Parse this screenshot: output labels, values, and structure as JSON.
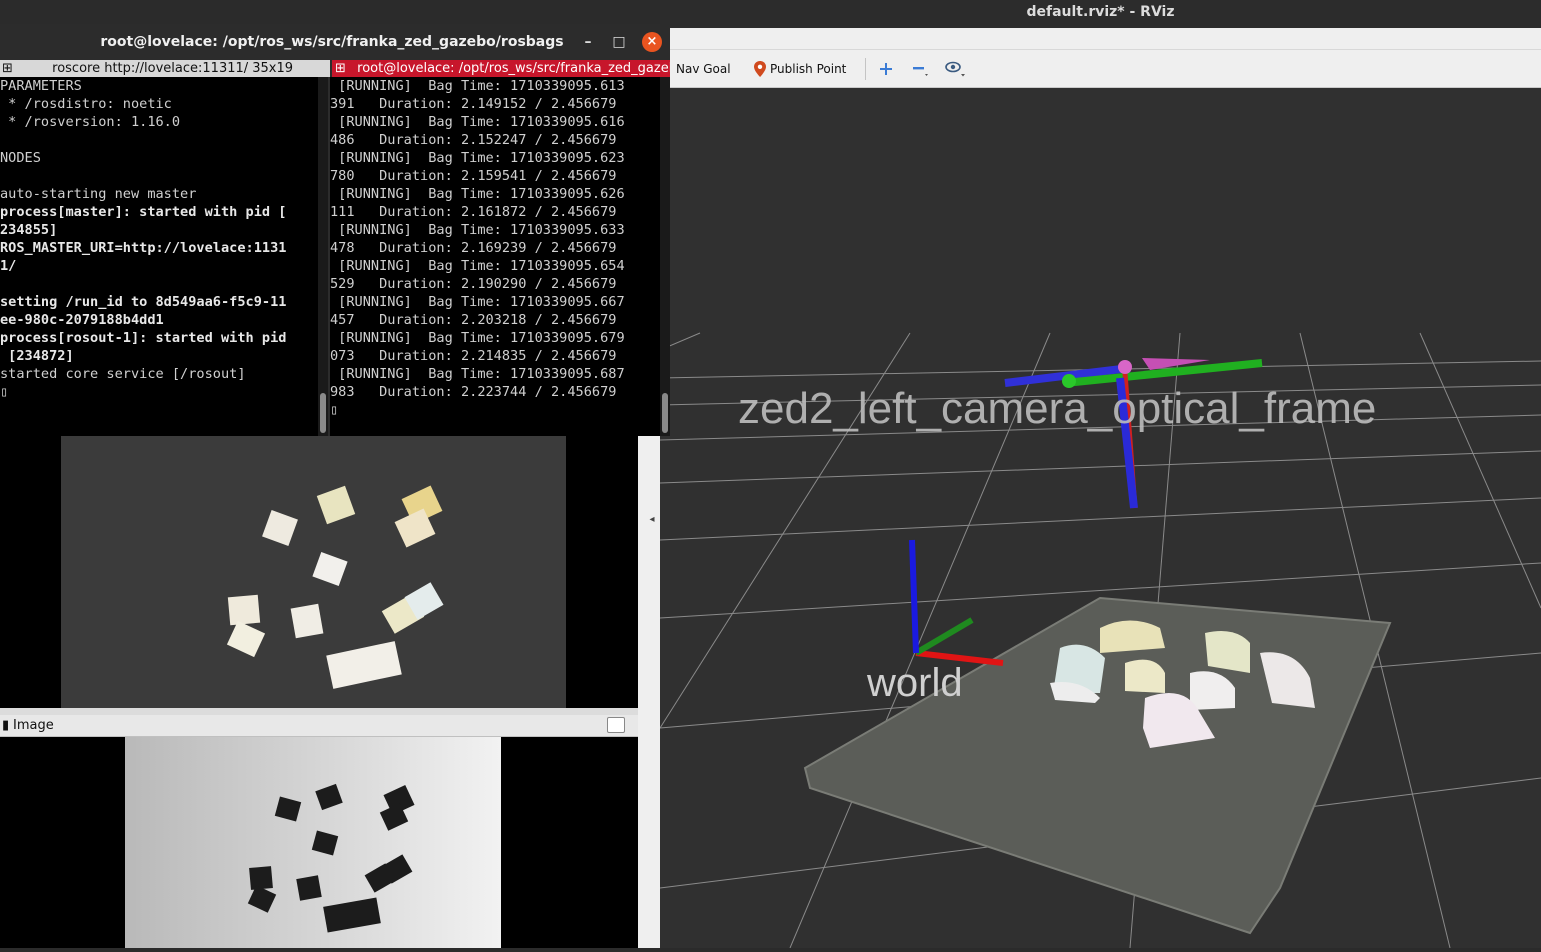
{
  "rviz": {
    "window_title": "default.rviz* - RViz",
    "toolbar": {
      "nav_goal_label": "Nav Goal",
      "publish_point_label": "Publish Point"
    },
    "view": {
      "frame_label_camera": "zed2_left_camera_optical_frame",
      "frame_label_world": "world"
    }
  },
  "terminal": {
    "window_title": "root@lovelace: /opt/ros_ws/src/franka_zed_gazebo/rosbags",
    "left_tab": "roscore http://lovelace:11311/ 35x19",
    "right_tab": "root@lovelace: /opt/ros_ws/src/franka_zed_gazebo/rosbags",
    "left_lines": [
      {
        "text": "PARAMETERS",
        "bold": false
      },
      {
        "text": " * /rosdistro: noetic",
        "bold": false
      },
      {
        "text": " * /rosversion: 1.16.0",
        "bold": false
      },
      {
        "text": "",
        "bold": false
      },
      {
        "text": "NODES",
        "bold": false
      },
      {
        "text": "",
        "bold": false
      },
      {
        "text": "auto-starting new master",
        "bold": false
      },
      {
        "text": "process[master]: started with pid [",
        "bold": true
      },
      {
        "text": "234855]",
        "bold": true
      },
      {
        "text": "ROS_MASTER_URI=http://lovelace:1131",
        "bold": true
      },
      {
        "text": "1/",
        "bold": true
      },
      {
        "text": "",
        "bold": false
      },
      {
        "text": "setting /run_id to 8d549aa6-f5c9-11",
        "bold": true
      },
      {
        "text": "ee-980c-2079188b4dd1",
        "bold": true
      },
      {
        "text": "process[rosout-1]: started with pid",
        "bold": true
      },
      {
        "text": " [234872]",
        "bold": true
      },
      {
        "text": "started core service [/rosout]",
        "bold": false
      },
      {
        "text": "▯",
        "bold": false
      }
    ],
    "right_lines": [
      " [RUNNING]  Bag Time: 1710339095.613",
      "391   Duration: 2.149152 / 2.456679",
      " [RUNNING]  Bag Time: 1710339095.616",
      "486   Duration: 2.152247 / 2.456679",
      " [RUNNING]  Bag Time: 1710339095.623",
      "780   Duration: 2.159541 / 2.456679",
      " [RUNNING]  Bag Time: 1710339095.626",
      "111   Duration: 2.161872 / 2.456679",
      " [RUNNING]  Bag Time: 1710339095.633",
      "478   Duration: 2.169239 / 2.456679",
      " [RUNNING]  Bag Time: 1710339095.654",
      "529   Duration: 2.190290 / 2.456679",
      " [RUNNING]  Bag Time: 1710339095.667",
      "457   Duration: 2.203218 / 2.456679",
      " [RUNNING]  Bag Time: 1710339095.679",
      "073   Duration: 2.214835 / 2.456679",
      " [RUNNING]  Bag Time: 1710339095.687",
      "983   Duration: 2.223744 / 2.456679",
      "▯"
    ]
  },
  "depth_window": {
    "title": "Image"
  },
  "colors": {
    "ubuntu_orange": "#e95420",
    "terminal_active_tab": "#c7162b",
    "rviz_background": "#303030"
  }
}
